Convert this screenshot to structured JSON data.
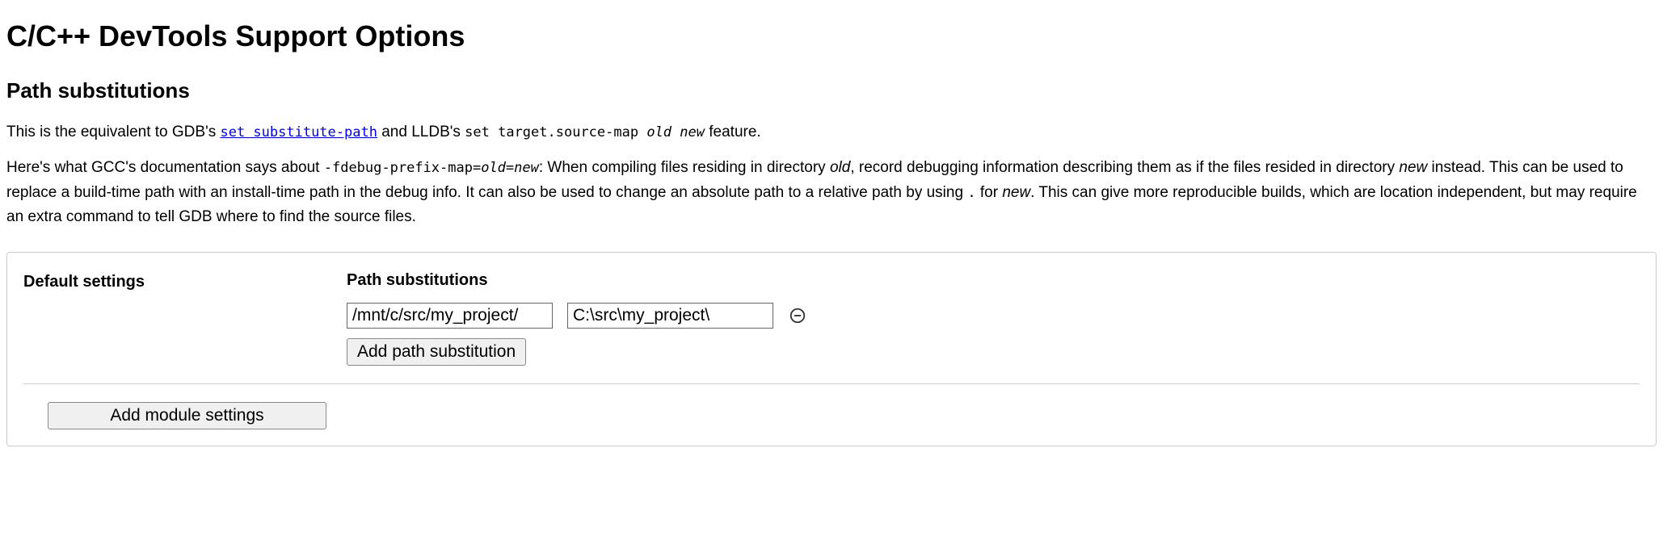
{
  "title": "C/C++ DevTools Support Options",
  "section": {
    "heading": "Path substitutions",
    "p1_prefix": "This is the equivalent to GDB's ",
    "p1_link_text": "set substitute-path",
    "p1_mid": " and LLDB's ",
    "p1_code2_a": "set target.source-map ",
    "p1_code2_b": "old new",
    "p1_suffix": " feature.",
    "p2_a": "Here's what GCC's documentation says about ",
    "p2_code_a": "-fdebug-prefix-map=",
    "p2_code_b": "old=new",
    "p2_b": ": When compiling files residing in directory ",
    "p2_c": "old",
    "p2_d": ", record debugging information describing them as if the files resided in directory ",
    "p2_e": "new",
    "p2_f": " instead. This can be used to replace a build-time path with an install-time path in the debug info. It can also be used to change an absolute path to a relative path by using ",
    "p2_g": ".",
    "p2_h": " for ",
    "p2_i": "new",
    "p2_j": ". This can give more reproducible builds, which are location independent, but may require an extra command to tell GDB where to find the source files."
  },
  "settings": {
    "left_label": "Default settings",
    "right_label": "Path substitutions",
    "from_value": "/mnt/c/src/my_project/",
    "to_value": "C:\\src\\my_project\\",
    "add_path_button": "Add path substitution",
    "add_module_button": "Add module settings"
  }
}
